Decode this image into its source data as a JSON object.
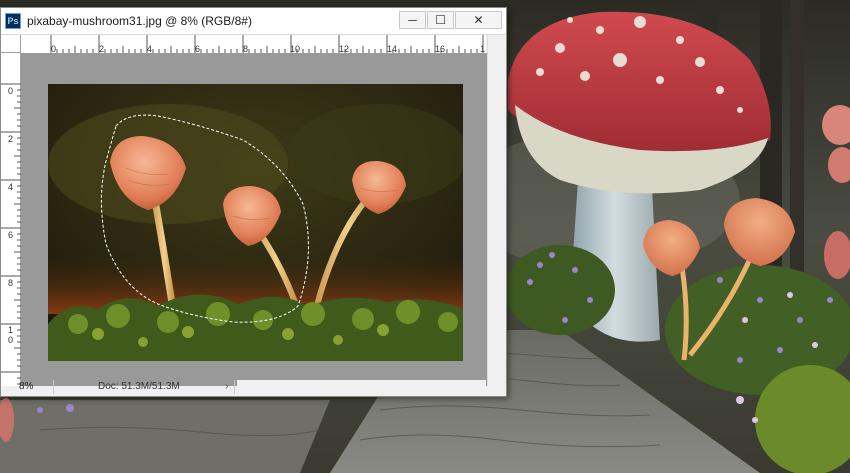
{
  "window": {
    "app_icon": "ps-icon",
    "app_icon_text": "Ps",
    "title": "pixabay-mushroom31.jpg @ 8% (RGB/8#)",
    "minimize_symbol": "─",
    "maximize_symbol": "☐",
    "close_symbol": "✕"
  },
  "rulers": {
    "horizontal_labels": [
      "0",
      "2",
      "4",
      "6",
      "8",
      "10",
      "12",
      "14",
      "16",
      "1"
    ],
    "vertical_labels": [
      "0",
      "2",
      "4",
      "6",
      "8",
      "1",
      "0"
    ]
  },
  "status": {
    "zoom": "8%",
    "doc_info": "Doc: 51.3M/51.3M",
    "arrow": "›"
  },
  "colors": {
    "titlebar": "#ffffff",
    "canvas_gray": "#999999",
    "mushroom_cap": "#e98a62",
    "red_cap": "#c6424a",
    "moss": "#4c6a1f"
  }
}
